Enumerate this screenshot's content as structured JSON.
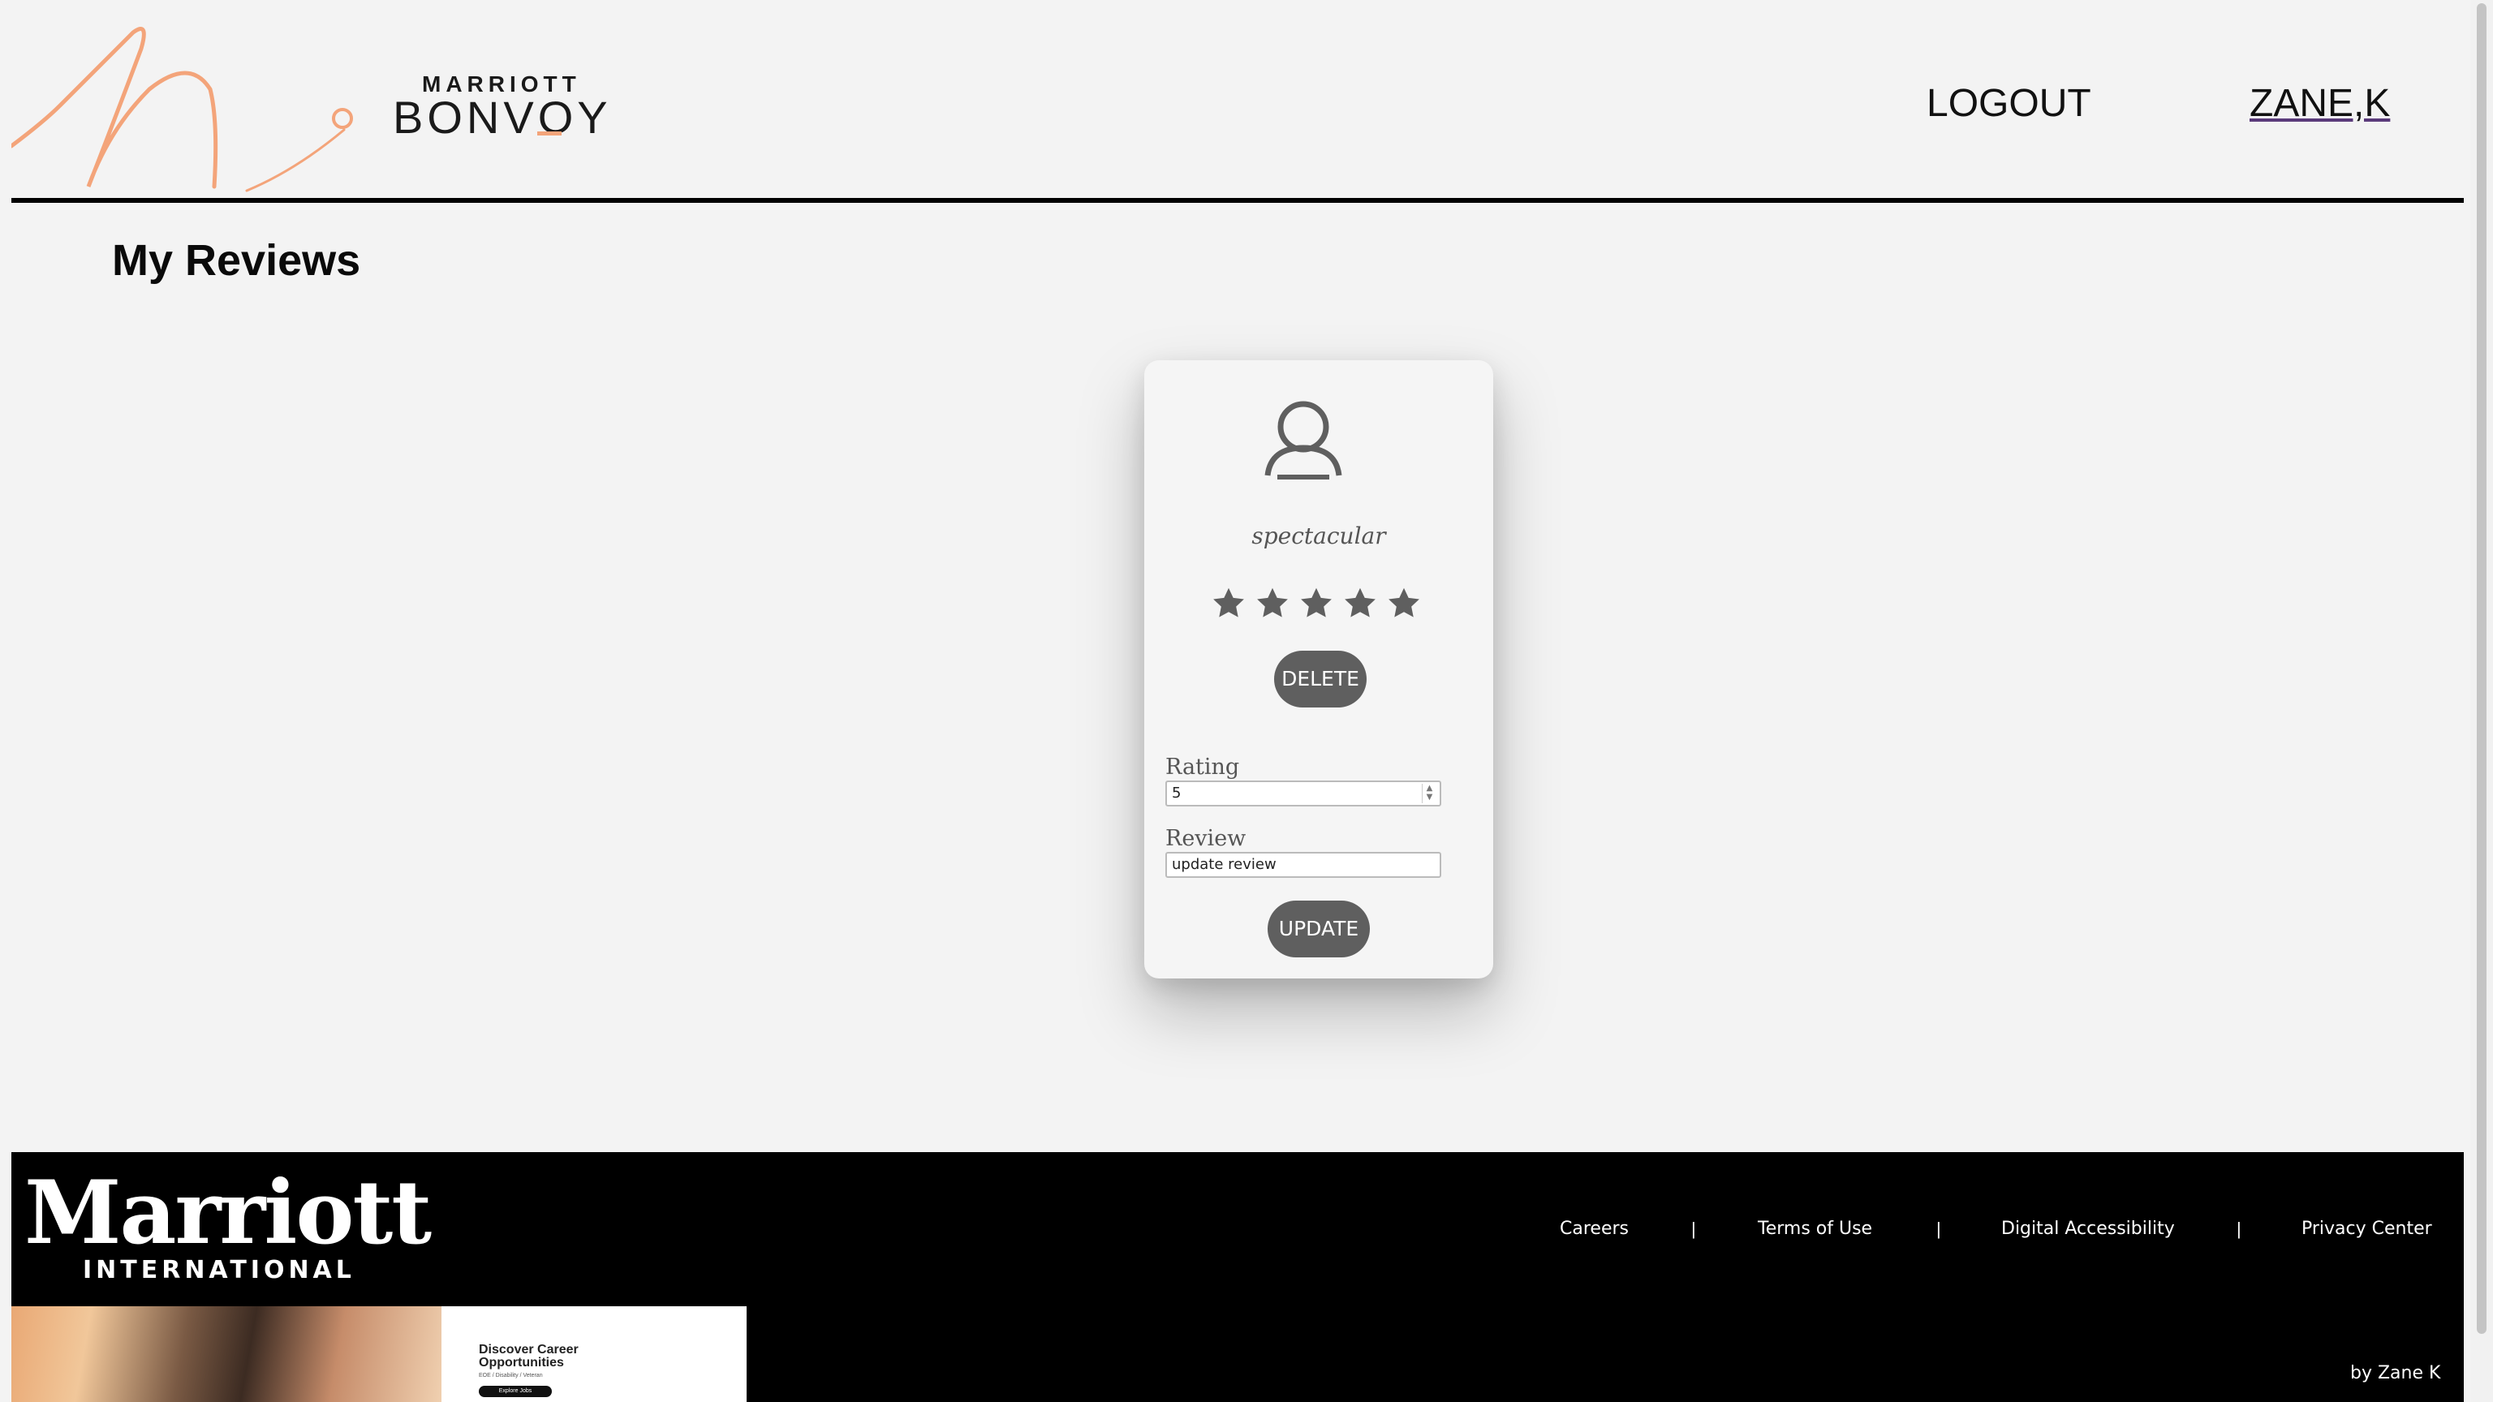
{
  "header": {
    "brand_top": "MARRIOTT",
    "brand_main": "BONVOY",
    "logout_label": "LOGOUT",
    "user_label": "ZANE,K"
  },
  "page": {
    "title": "My Reviews"
  },
  "review_card": {
    "review_text": "spectacular",
    "stars": 5,
    "delete_label": "DELETE",
    "rating_label": "Rating",
    "rating_value": "5",
    "review_label": "Review",
    "review_value": "update review",
    "update_label": "UPDATE"
  },
  "footer": {
    "logo_word": "Marriott",
    "logo_sub": "INTERNATIONAL",
    "links": [
      "Careers",
      "Terms of Use",
      "Digital Accessibility",
      "Privacy Center"
    ],
    "separator": "|",
    "byline": "by Zane K",
    "ad": {
      "title": "Discover Career Opportunities",
      "subtitle": "EOE / Disability / Veteran",
      "button": "Explore Jobs"
    }
  },
  "colors": {
    "accent": "#f3a47a",
    "button": "#5f5f5f",
    "background": "#f3f3f3",
    "footer": "#000000"
  },
  "icons": [
    "user-avatar-icon",
    "star-icon",
    "spinner-arrows-icon"
  ]
}
